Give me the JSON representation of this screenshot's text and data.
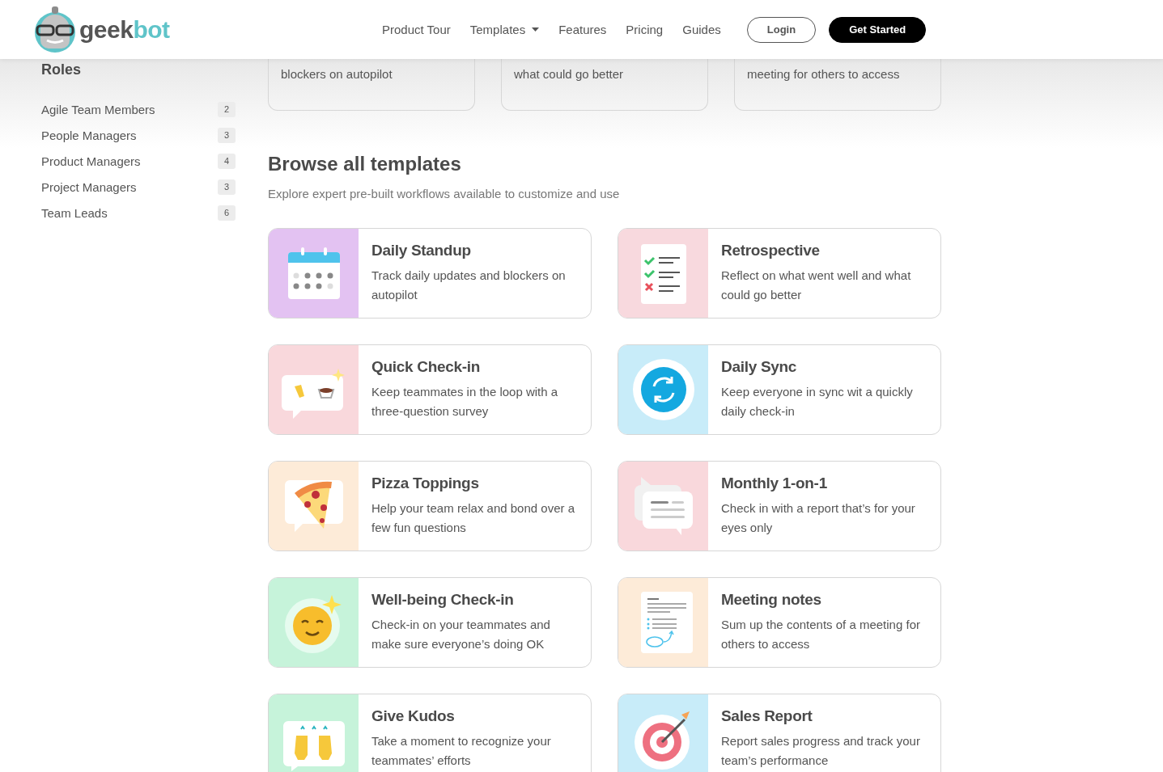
{
  "header": {
    "logo": {
      "part_1": "geek",
      "part_2": "bot"
    },
    "nav": [
      {
        "label": "Product Tour",
        "has_menu": false
      },
      {
        "label": "Templates",
        "has_menu": true
      },
      {
        "label": "Features",
        "has_menu": false
      },
      {
        "label": "Pricing",
        "has_menu": false
      },
      {
        "label": "Guides",
        "has_menu": false
      }
    ],
    "buttons": [
      {
        "label": "Login",
        "kind": "outline"
      },
      {
        "label": "Get Started",
        "kind": "filled"
      }
    ]
  },
  "sidebar": {
    "title": "Roles",
    "items": [
      {
        "label": "Agile Team Members",
        "count": "2"
      },
      {
        "label": "People Managers",
        "count": "3"
      },
      {
        "label": "Product Managers",
        "count": "4"
      },
      {
        "label": "Project Managers",
        "count": "3"
      },
      {
        "label": "Team Leads",
        "count": "6"
      }
    ]
  },
  "featured": [
    "blockers on autopilot",
    "what could go better",
    "meeting for others to access"
  ],
  "browse": {
    "title": "Browse all templates",
    "subtitle": "Explore expert pre-built workflows available to customize and use"
  },
  "templates": [
    {
      "title": "Daily Standup",
      "description": "Track daily updates and blockers on autopilot",
      "kind": "calendar",
      "color": "#e3c2f2"
    },
    {
      "title": "Retrospective",
      "description": "Reflect on what went well and what could go better",
      "kind": "checklist",
      "color": "#f8d9de"
    },
    {
      "title": "Quick Check-in",
      "description": "Keep teammates in the loop with a three-question survey",
      "kind": "wave",
      "color": "#f9d8dc"
    },
    {
      "title": "Daily Sync",
      "description": "Keep everyone in sync wit a quickly daily check-in",
      "kind": "sync",
      "color": "#c8ecf9"
    },
    {
      "title": "Pizza Toppings",
      "description": "Help your team relax and bond over a few fun questions",
      "kind": "pizza",
      "color": "#fdebd8"
    },
    {
      "title": "Monthly 1-on-1",
      "description": "Check in with a report that’s for your eyes only",
      "kind": "chat",
      "color": "#f9d8dc"
    },
    {
      "title": "Well-being Check-in",
      "description": "Check-in on your teammates and make sure everyone’s doing OK",
      "kind": "smile",
      "color": "#c6f3da"
    },
    {
      "title": "Meeting notes",
      "description": "Sum up the contents of a meeting for others to access",
      "kind": "notes",
      "color": "#fdebd8"
    },
    {
      "title": "Give Kudos",
      "description": "Take a moment to recognize your teammates’ efforts",
      "kind": "hands",
      "color": "#c6f3da"
    },
    {
      "title": "Sales Report",
      "description": "Report sales progress and track your team’s performance",
      "kind": "target",
      "color": "#c8ecf9"
    }
  ]
}
